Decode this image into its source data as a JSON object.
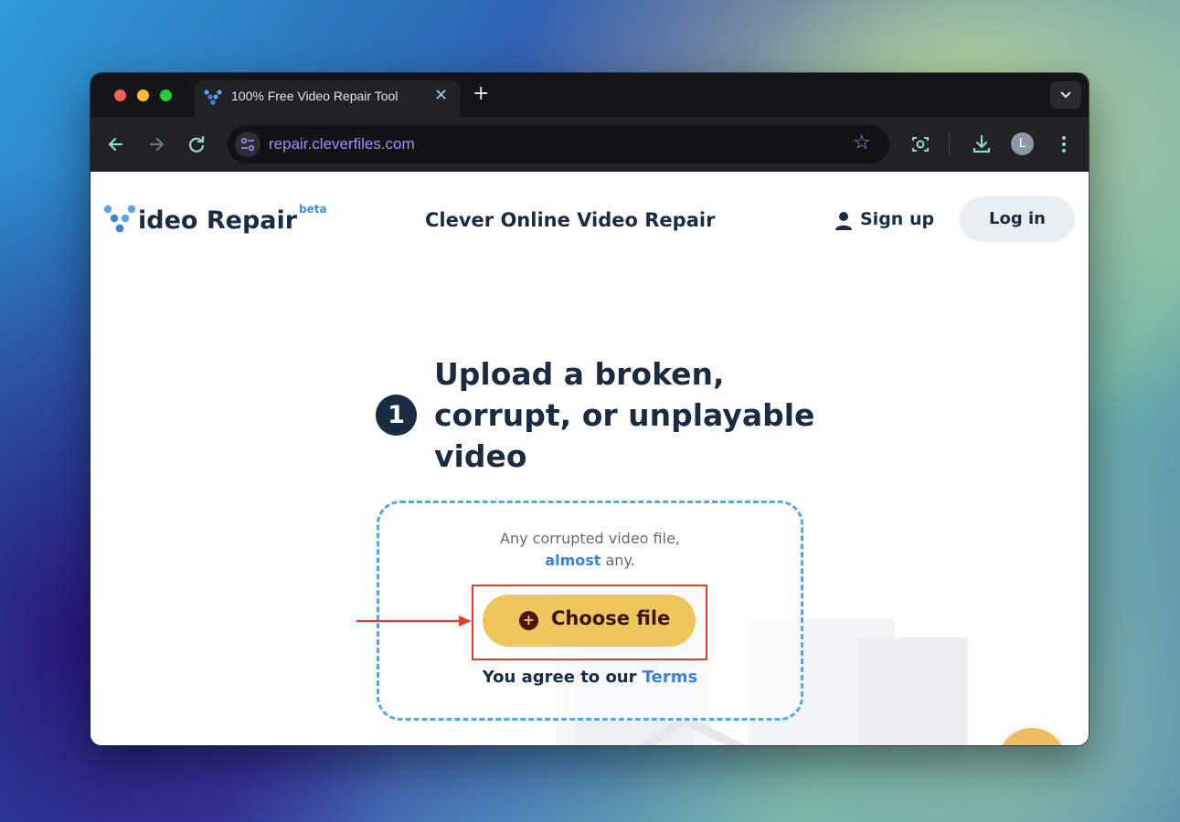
{
  "browser": {
    "tab_title": "100% Free Video Repair Tool",
    "url": "repair.cleverfiles.com",
    "profile_initial": "L"
  },
  "header": {
    "logo_text": "ideo Repair",
    "logo_badge": "beta",
    "site_title": "Clever Online Video Repair",
    "signup_label": "Sign up",
    "login_label": "Log in"
  },
  "upload": {
    "step_number": "1",
    "headline": "Upload a broken, corrupt, or unplayable video",
    "note_line1": "Any corrupted video file,",
    "note_highlight": "almost",
    "note_rest": " any.",
    "choose_label": "Choose file",
    "terms_prefix": "You agree to our ",
    "terms_link": "Terms"
  },
  "colors": {
    "accent_blue": "#3d82d6",
    "button_yellow": "#edc75c",
    "highlight_red": "#e23c2a",
    "dark_text": "#1b2c42"
  }
}
